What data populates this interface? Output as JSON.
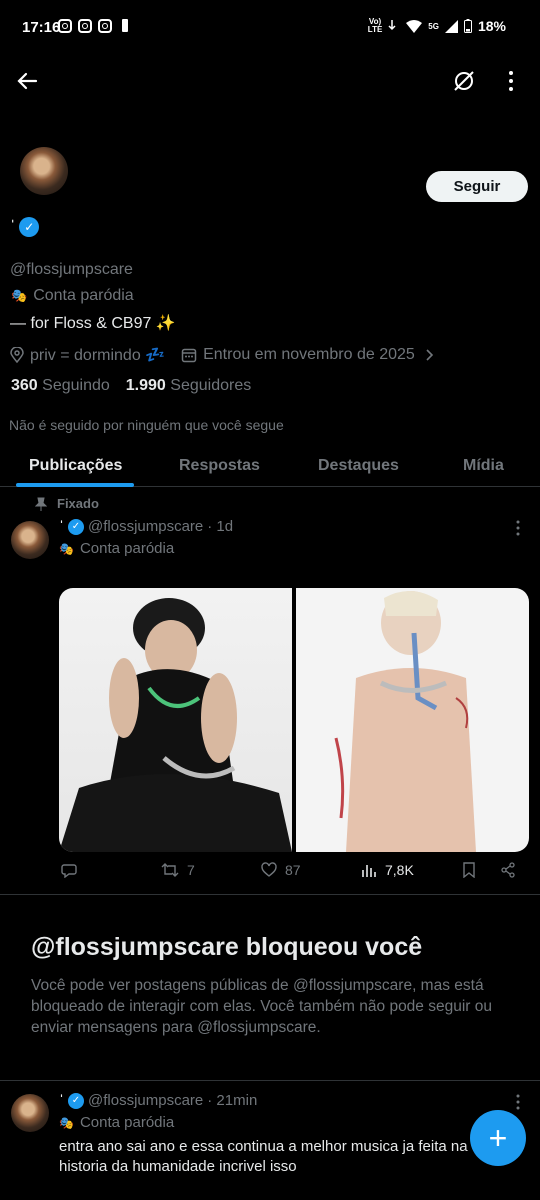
{
  "status_bar": {
    "time": "17:16",
    "network": "Vo)\nLTE",
    "signal_label": "5G",
    "battery": "18%"
  },
  "profile": {
    "display_name": "ˈ",
    "handle": "@flossjumpscare",
    "parody_label": "Conta paródia",
    "bio": "— for Floss & CB97 ✨",
    "location": "priv = dormindo 💤",
    "joined": "Entrou em novembro de 2025",
    "following_count": "360",
    "following_label": "Seguindo",
    "followers_count": "1.990",
    "followers_label": "Seguidores",
    "not_followed_note": "Não é seguido por ninguém que você segue",
    "follow_button": "Seguir"
  },
  "tabs": [
    {
      "label": "Publicações",
      "active": true
    },
    {
      "label": "Respostas",
      "active": false
    },
    {
      "label": "Destaques",
      "active": false
    },
    {
      "label": "Mídia",
      "active": false
    }
  ],
  "pinned_post": {
    "pinned_label": "Fixado",
    "display_name": "ˈ",
    "handle": "@flossjumpscare",
    "time": "· 1d",
    "parody_label": "Conta paródia",
    "stats": {
      "retweets": "7",
      "likes": "87",
      "views": "7,8K"
    }
  },
  "blocked_notice": {
    "title": "@flossjumpscare bloqueou você",
    "body": "Você pode ver postagens públicas de @flossjumpscare, mas está bloqueado de interagir com elas. Você também não pode seguir ou enviar mensagens para @flossjumpscare."
  },
  "second_post": {
    "display_name": "ˈ",
    "handle": "@flossjumpscare",
    "time": "· 21min",
    "parody_label": "Conta paródia",
    "text": "entra ano sai ano e essa continua a melhor musica ja feita na historia da humanidade incrivel isso"
  },
  "fab_label": "+",
  "colors": {
    "accent": "#1d9bf0",
    "background": "#000000",
    "muted": "#71767b",
    "divider": "#2f3336"
  }
}
